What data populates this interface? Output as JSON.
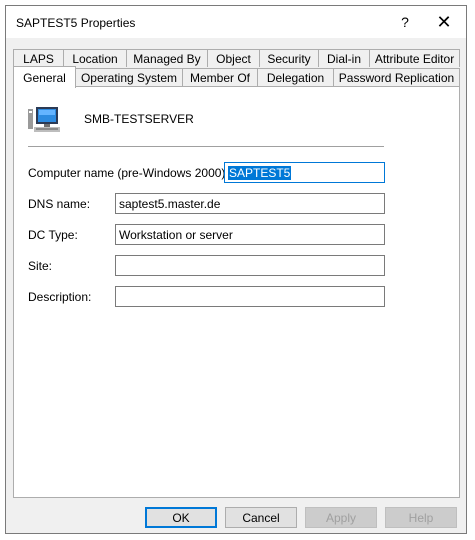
{
  "window": {
    "title": "SAPTEST5 Properties",
    "help_glyph": "?",
    "close_glyph": "✕"
  },
  "tabs_row1": [
    "LAPS",
    "Location",
    "Managed By",
    "Object",
    "Security",
    "Dial-in",
    "Attribute Editor"
  ],
  "tabs_row2": [
    "General",
    "Operating System",
    "Member Of",
    "Delegation",
    "Password Replication"
  ],
  "active_tab": "General",
  "general": {
    "server_name": "SMB-TESTSERVER",
    "computer_name_label": "Computer name (pre-Windows 2000):",
    "computer_name_value": "SAPTEST5",
    "dns_name_label": "DNS name:",
    "dns_name_value": "saptest5.master.de",
    "dc_type_label": "DC Type:",
    "dc_type_value": "Workstation or server",
    "site_label": "Site:",
    "site_value": "",
    "description_label": "Description:",
    "description_value": ""
  },
  "buttons": {
    "ok": "OK",
    "cancel": "Cancel",
    "apply": "Apply",
    "help": "Help"
  },
  "colors": {
    "selection": "#0078d7",
    "window_bg": "#f0f0f0"
  }
}
